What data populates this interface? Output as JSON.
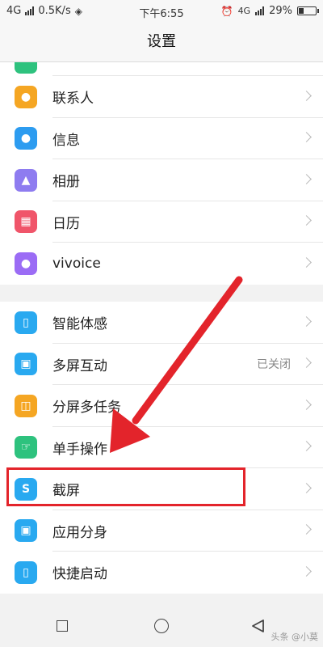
{
  "status_bar": {
    "network": "4G",
    "speed": "0.5K/s",
    "time": "下午6:55",
    "network_right": "4G",
    "battery": "29%",
    "battery_level": 0.29
  },
  "header": {
    "title": "设置"
  },
  "group1": [
    {
      "label": "联系人",
      "icon": "contacts-icon",
      "color": "#f5a623"
    },
    {
      "label": "信息",
      "icon": "messages-icon",
      "color": "#2d9cf0"
    },
    {
      "label": "相册",
      "icon": "album-icon",
      "color": "#8e7cf0"
    },
    {
      "label": "日历",
      "icon": "calendar-icon",
      "color": "#f0556a"
    },
    {
      "label": "vivoice",
      "icon": "microphone-icon",
      "color": "#9b6cf5"
    }
  ],
  "group2": [
    {
      "label": "智能体感",
      "icon": "smart-motion-icon",
      "color": "#29a9f0",
      "value": ""
    },
    {
      "label": "多屏互动",
      "icon": "multi-screen-icon",
      "color": "#29a9f0",
      "value": "已关闭"
    },
    {
      "label": "分屏多任务",
      "icon": "split-screen-icon",
      "color": "#f5a623",
      "value": ""
    },
    {
      "label": "单手操作",
      "icon": "one-hand-icon",
      "color": "#2ec27e",
      "value": ""
    },
    {
      "label": "截屏",
      "icon": "screenshot-icon",
      "color": "#29a9f0",
      "value": ""
    },
    {
      "label": "应用分身",
      "icon": "app-clone-icon",
      "color": "#29a9f0",
      "value": ""
    },
    {
      "label": "快捷启动",
      "icon": "quick-launch-icon",
      "color": "#29a9f0",
      "value": ""
    }
  ],
  "watermark": "头条 @小莫"
}
